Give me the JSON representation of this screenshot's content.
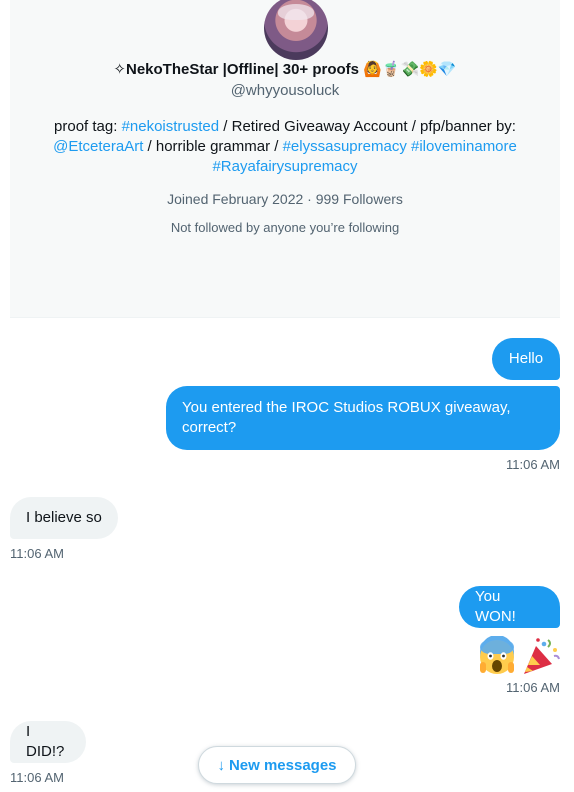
{
  "profile": {
    "display_name": "✧NekoTheStar |Offline| 30+ proofs 🙆🧋💸🌼💎",
    "handle": "@whyyousoluck",
    "bio": [
      {
        "text": "proof tag: ",
        "link": false
      },
      {
        "text": "#nekoistrusted",
        "link": true
      },
      {
        "text": " / Retired Giveaway Account / pfp/banner by: ",
        "link": false
      },
      {
        "text": "@EtceteraArt",
        "link": true
      },
      {
        "text": " / horrible grammar / ",
        "link": false
      },
      {
        "text": "#elyssasupremacy",
        "link": true
      },
      {
        "text": " ",
        "link": false
      },
      {
        "text": "#iloveminamore",
        "link": true
      },
      {
        "text": " ",
        "link": false
      },
      {
        "text": "#Rayafairysupremacy",
        "link": true
      }
    ],
    "joined_followers": "Joined February 2022 · 999 Followers",
    "followed_by": "Not followed by anyone you’re following"
  },
  "messages": [
    {
      "text": "Hello"
    },
    {
      "text": "You entered the IROC Studios ROBUX giveaway, correct?"
    },
    {
      "text": "I believe so"
    },
    {
      "text": "You WON!"
    },
    {
      "text": "I DID!?"
    }
  ],
  "timestamps": [
    "11:06 AM",
    "11:06 AM",
    "11:06 AM",
    "11:06 AM"
  ],
  "emoji_message": {
    "icons": [
      "screaming-face",
      "party-popper"
    ]
  },
  "new_messages_button": {
    "arrow": "↓",
    "label": "New messages"
  },
  "colors": {
    "accent": "#1d9bf0",
    "received_bubble": "#eff3f4",
    "card_bg": "#f7f9f9",
    "muted_text": "#536471"
  }
}
